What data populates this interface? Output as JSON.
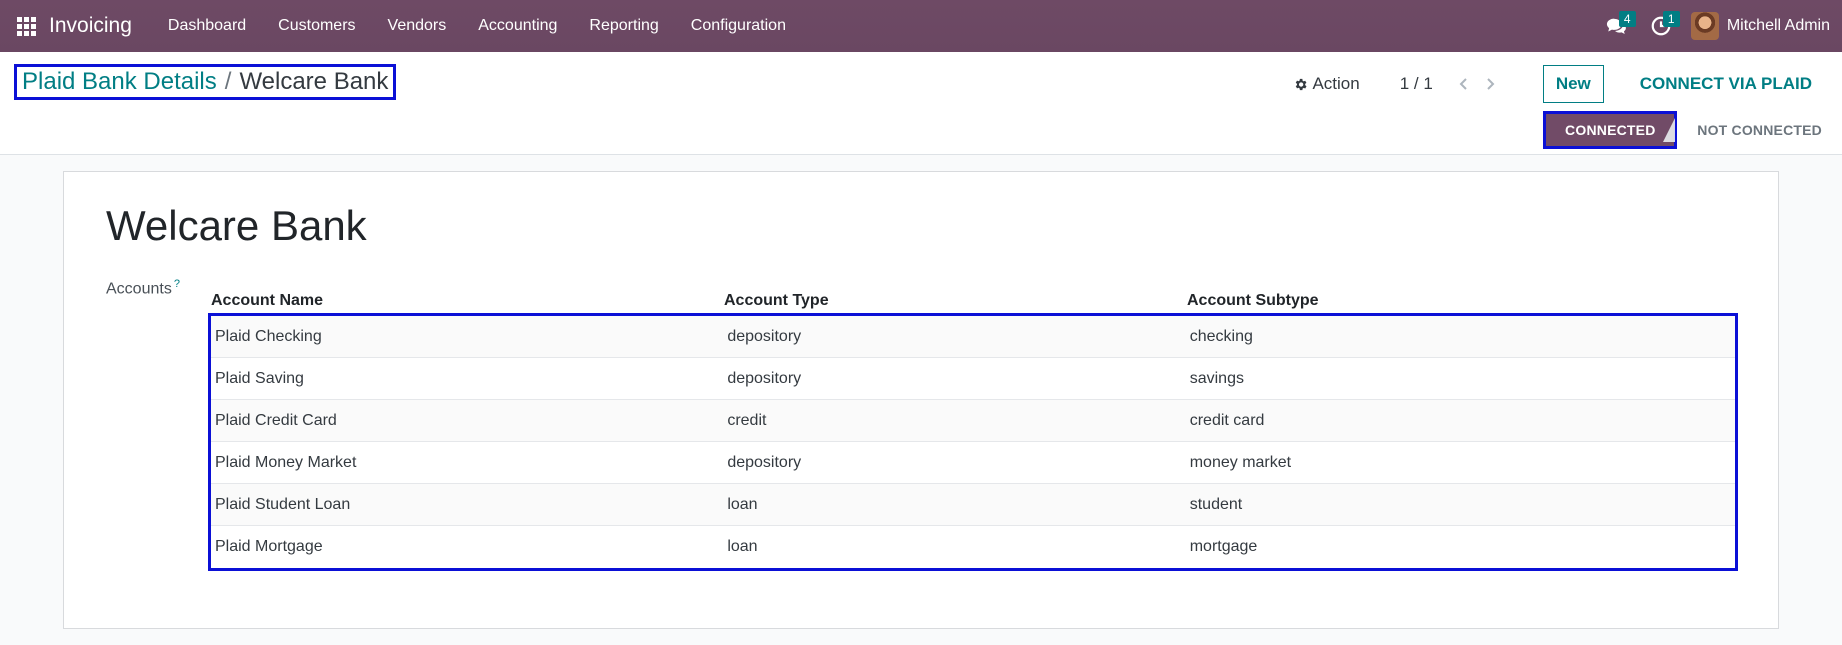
{
  "navbar": {
    "app_name": "Invoicing",
    "menu": [
      "Dashboard",
      "Customers",
      "Vendors",
      "Accounting",
      "Reporting",
      "Configuration"
    ],
    "messages_count": "4",
    "activities_count": "1",
    "user_name": "Mitchell Admin"
  },
  "breadcrumb": {
    "parent": "Plaid Bank Details",
    "separator": "/",
    "current": "Welcare Bank"
  },
  "control": {
    "action_label": "Action",
    "pager_value": "1 / 1",
    "new_label": "New",
    "connect_label": "CONNECT VIA PLAID"
  },
  "status": {
    "active": "CONNECTED",
    "inactive": "NOT CONNECTED"
  },
  "form": {
    "title": "Welcare Bank",
    "accounts_label": "Accounts",
    "help_mark": "?",
    "columns": [
      "Account Name",
      "Account Type",
      "Account Subtype"
    ],
    "rows": [
      [
        "Plaid Checking",
        "depository",
        "checking"
      ],
      [
        "Plaid Saving",
        "depository",
        "savings"
      ],
      [
        "Plaid Credit Card",
        "credit",
        "credit card"
      ],
      [
        "Plaid Money Market",
        "depository",
        "money market"
      ],
      [
        "Plaid Student Loan",
        "loan",
        "student"
      ],
      [
        "Plaid Mortgage",
        "loan",
        "mortgage"
      ]
    ]
  },
  "colors": {
    "navbar": "#714b67",
    "accent": "#017e84",
    "highlight_border": "#0b10d6"
  }
}
